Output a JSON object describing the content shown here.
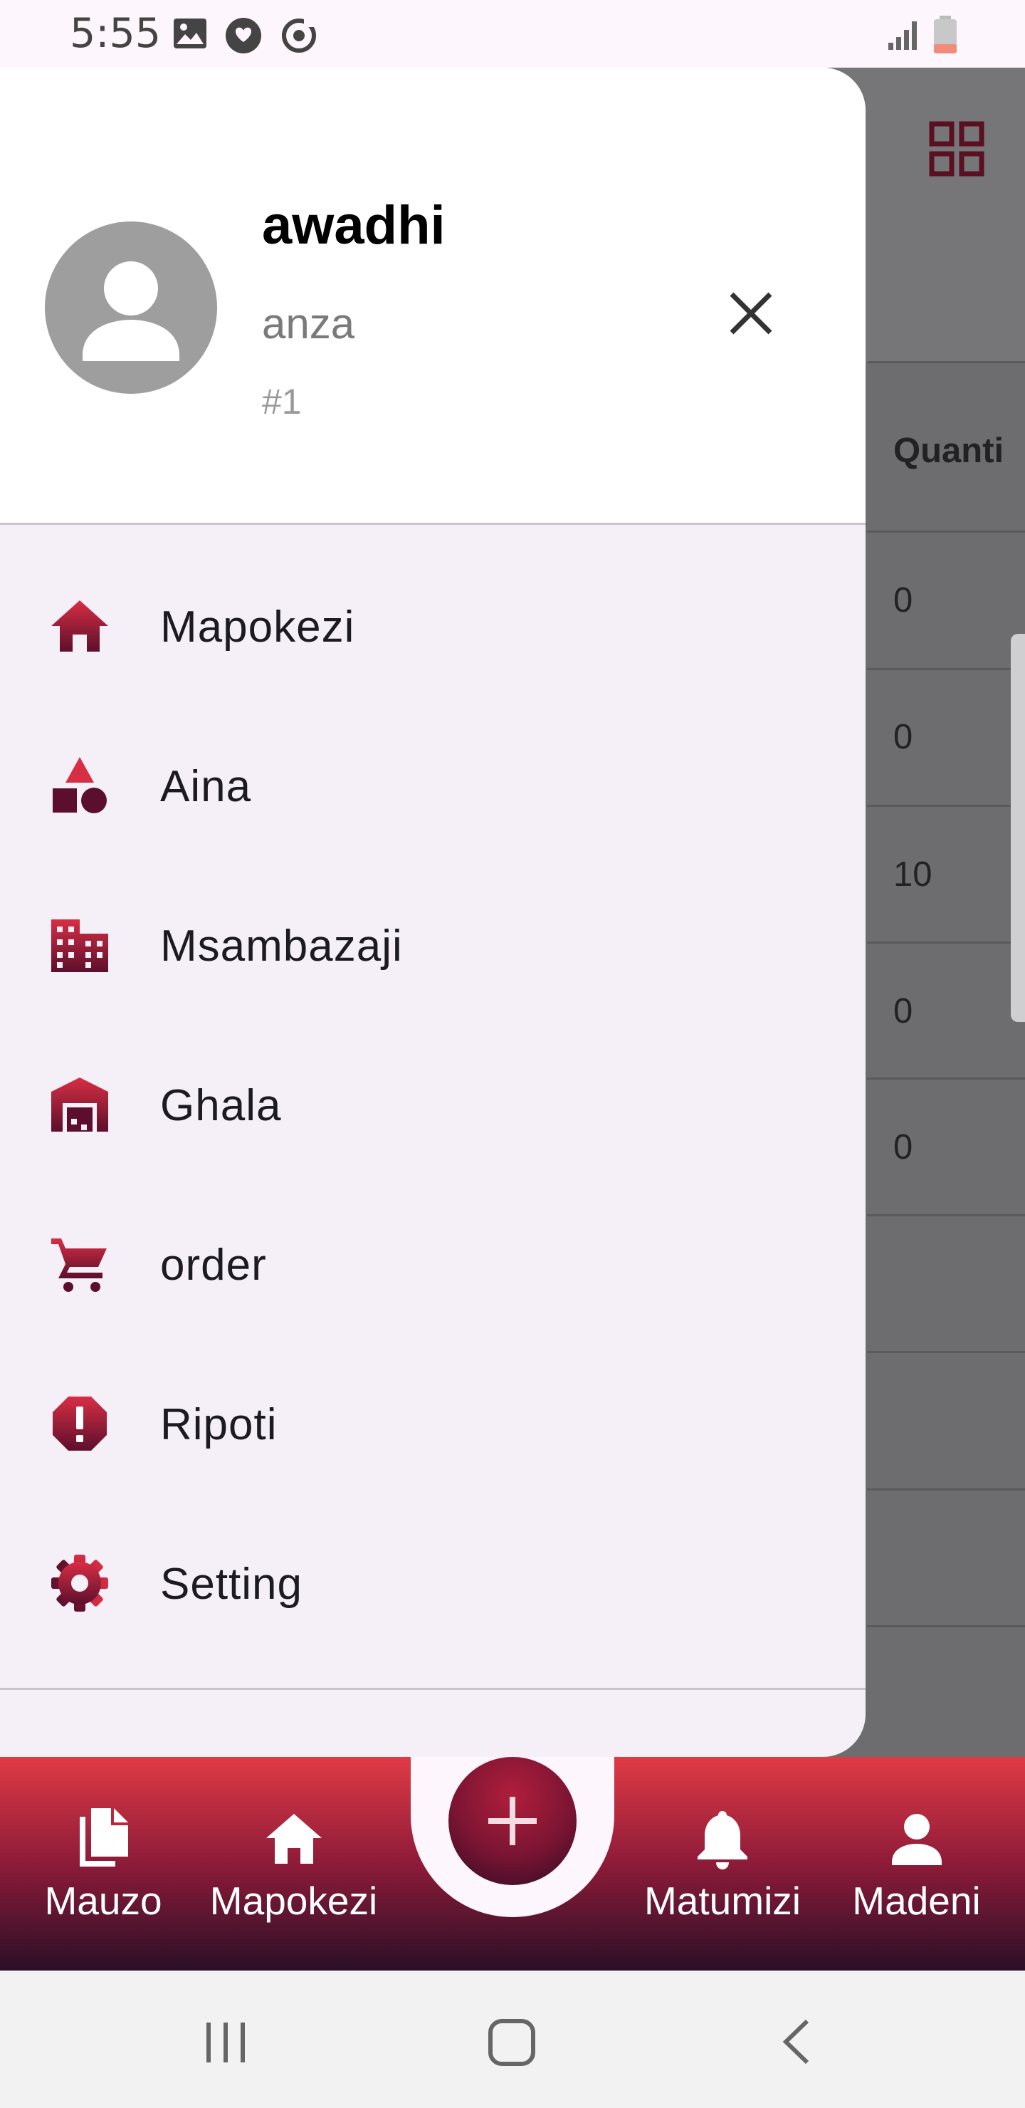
{
  "status_bar": {
    "time": "5:55"
  },
  "background": {
    "column_header": "Quanti",
    "rows": [
      "0",
      "0",
      "10",
      "0",
      "0",
      "",
      "",
      ""
    ]
  },
  "drawer": {
    "user": {
      "name": "awadhi",
      "subtitle": "anza",
      "id": "#1"
    },
    "menu": [
      {
        "label": "Mapokezi",
        "icon": "home-icon"
      },
      {
        "label": "Aina",
        "icon": "category-shapes-icon"
      },
      {
        "label": "Msambazaji",
        "icon": "building-icon"
      },
      {
        "label": "Ghala",
        "icon": "warehouse-icon"
      },
      {
        "label": "order",
        "icon": "cart-icon"
      },
      {
        "label": "Ripoti",
        "icon": "report-alert-icon"
      },
      {
        "label": "Setting",
        "icon": "gear-icon"
      }
    ]
  },
  "bottom_nav": {
    "items": [
      {
        "label": "Mauzo",
        "icon": "documents-icon"
      },
      {
        "label": "Mapokezi",
        "icon": "home-icon"
      },
      {
        "label": "Matumizi",
        "icon": "bell-icon"
      },
      {
        "label": "Madeni",
        "icon": "person-icon"
      }
    ],
    "fab_icon": "plus-icon"
  },
  "colors": {
    "accent_dark": "#7a1433",
    "accent_red": "#e03a45",
    "drawer_bg": "#f5eff7"
  }
}
